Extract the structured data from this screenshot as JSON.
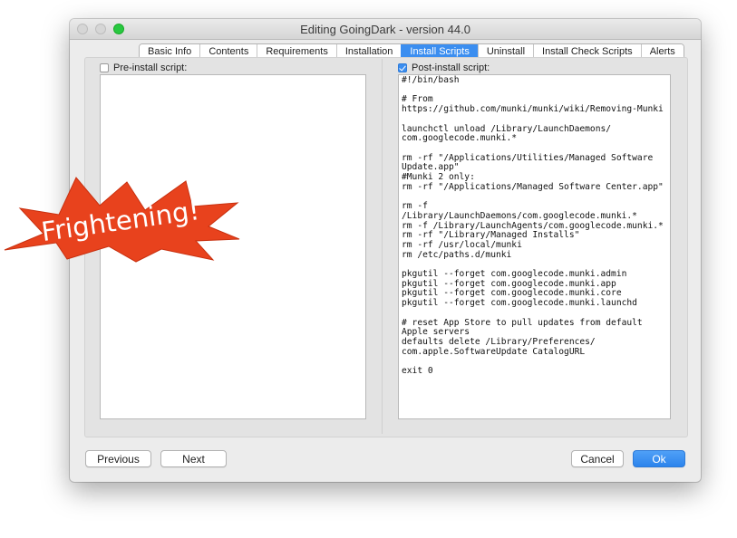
{
  "window": {
    "title": "Editing GoingDark - version 44.0"
  },
  "tabs": [
    {
      "label": "Basic Info"
    },
    {
      "label": "Contents"
    },
    {
      "label": "Requirements"
    },
    {
      "label": "Installation"
    },
    {
      "label": "Install Scripts",
      "active": true
    },
    {
      "label": "Uninstall"
    },
    {
      "label": "Install Check Scripts"
    },
    {
      "label": "Alerts"
    }
  ],
  "pre_install": {
    "label": "Pre-install script:",
    "checked": false,
    "content": ""
  },
  "post_install": {
    "label": "Post-install script:",
    "checked": true,
    "content": "#!/bin/bash\n\n# From https://github.com/munki/munki/wiki/Removing-Munki\n\nlaunchctl unload /Library/LaunchDaemons/\ncom.googlecode.munki.*\n\nrm -rf \"/Applications/Utilities/Managed Software\nUpdate.app\"\n#Munki 2 only:\nrm -rf \"/Applications/Managed Software Center.app\"\n\nrm -f /Library/LaunchDaemons/com.googlecode.munki.*\nrm -f /Library/LaunchAgents/com.googlecode.munki.*\nrm -rf \"/Library/Managed Installs\"\nrm -rf /usr/local/munki\nrm /etc/paths.d/munki\n\npkgutil --forget com.googlecode.munki.admin\npkgutil --forget com.googlecode.munki.app\npkgutil --forget com.googlecode.munki.core\npkgutil --forget com.googlecode.munki.launchd\n\n# reset App Store to pull updates from default Apple servers\ndefaults delete /Library/Preferences/\ncom.apple.SoftwareUpdate CatalogURL\n\nexit 0"
  },
  "buttons": {
    "previous": "Previous",
    "next": "Next",
    "cancel": "Cancel",
    "ok": "Ok"
  },
  "overlay": {
    "text": "Frightening!",
    "fill_color": "#e8421d",
    "text_color": "#ffffff"
  },
  "colors": {
    "accent": "#3b8ef0",
    "window_bg": "#ececec",
    "traffic_green": "#28c840"
  }
}
